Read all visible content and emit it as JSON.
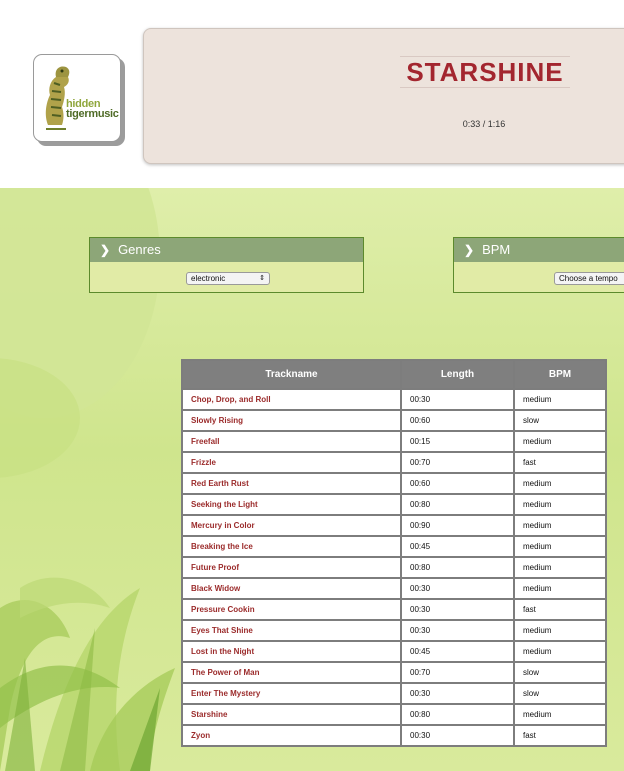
{
  "logo": {
    "line1": "hidden",
    "line2": "tigermusic",
    "icon": "tiger-icon"
  },
  "player": {
    "title": "STARSHINE",
    "time": "0:33 / 1:16"
  },
  "filters": [
    {
      "label": "Genres",
      "icon": "chevron-right-icon",
      "selected": "electronic"
    },
    {
      "label": "BPM",
      "icon": "chevron-right-icon",
      "selected": "Choose a tempo"
    }
  ],
  "table": {
    "headers": [
      "Trackname",
      "Length",
      "BPM"
    ],
    "rows": [
      [
        "Chop, Drop, and Roll",
        "00:30",
        "medium"
      ],
      [
        "Slowly Rising",
        "00:60",
        "slow"
      ],
      [
        "Freefall",
        "00:15",
        "medium"
      ],
      [
        "Frizzle",
        "00:70",
        "fast"
      ],
      [
        "Red Earth Rust",
        "00:60",
        "medium"
      ],
      [
        "Seeking the Light",
        "00:80",
        "medium"
      ],
      [
        "Mercury in Color",
        "00:90",
        "medium"
      ],
      [
        "Breaking the Ice",
        "00:45",
        "medium"
      ],
      [
        "Future Proof",
        "00:80",
        "medium"
      ],
      [
        "Black Widow",
        "00:30",
        "medium"
      ],
      [
        "Pressure Cookin",
        "00:30",
        "fast"
      ],
      [
        "Eyes That Shine",
        "00:30",
        "medium"
      ],
      [
        "Lost in the Night",
        "00:45",
        "medium"
      ],
      [
        "The Power of Man",
        "00:70",
        "slow"
      ],
      [
        "Enter The Mystery",
        "00:30",
        "slow"
      ],
      [
        "Starshine",
        "00:80",
        "medium"
      ],
      [
        "Zyon",
        "00:30",
        "fast"
      ]
    ]
  },
  "colors": {
    "title": "#a3262f",
    "track_name": "#9b2b2b",
    "panel_header": "#8da678",
    "table_header": "#7f7f7f"
  }
}
